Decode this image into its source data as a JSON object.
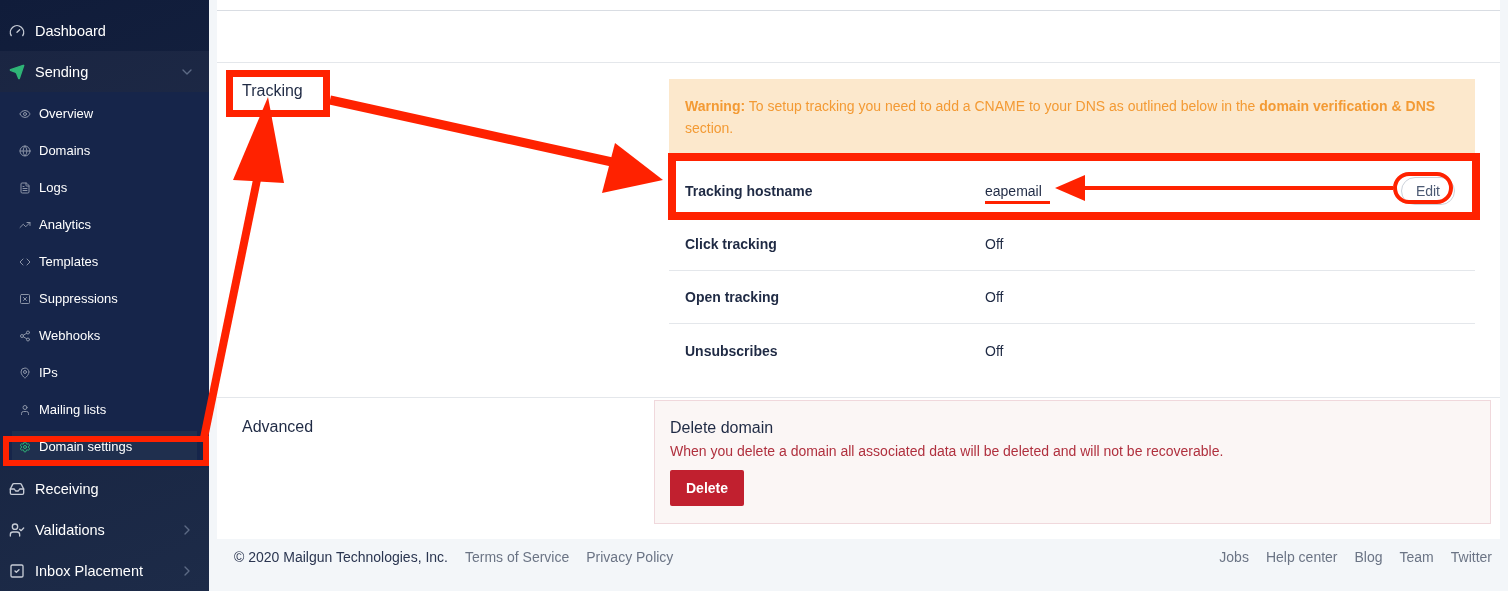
{
  "sidebar": {
    "items": [
      {
        "label": "Dashboard"
      },
      {
        "label": "Sending",
        "expanded": true,
        "children": [
          {
            "label": "Overview",
            "selected": false
          },
          {
            "label": "Domains",
            "selected": false
          },
          {
            "label": "Logs",
            "selected": false
          },
          {
            "label": "Analytics",
            "selected": false
          },
          {
            "label": "Templates",
            "selected": false
          },
          {
            "label": "Suppressions",
            "selected": false
          },
          {
            "label": "Webhooks",
            "selected": false
          },
          {
            "label": "IPs",
            "selected": false
          },
          {
            "label": "Mailing lists",
            "selected": false
          },
          {
            "label": "Domain settings",
            "selected": true
          }
        ]
      },
      {
        "label": "Receiving"
      },
      {
        "label": "Validations",
        "expanded": false
      },
      {
        "label": "Inbox Placement",
        "expanded": false
      }
    ]
  },
  "tracking": {
    "title": "Tracking",
    "warning": "**Warning:** To setup tracking you need to add a CNAME to your DNS as outlined below in the **domain verification & DNS** section.",
    "rows": [
      {
        "label": "Tracking hostname",
        "value": "eapemail",
        "action": "Edit"
      },
      {
        "label": "Click tracking",
        "value": "Off"
      },
      {
        "label": "Open tracking",
        "value": "Off"
      },
      {
        "label": "Unsubscribes",
        "value": "Off"
      }
    ]
  },
  "advanced": {
    "title": "Advanced",
    "danger_title": "Delete domain",
    "danger_text": "When you delete a domain all associated data will be deleted and will not be recoverable.",
    "button": "Delete"
  },
  "footer": {
    "copyright": "© 2020 Mailgun Technologies, Inc.",
    "left_links": [
      "Terms of Service",
      "Privacy Policy"
    ],
    "right_links": [
      "Jobs",
      "Help center",
      "Blog",
      "Team",
      "Twitter"
    ]
  }
}
